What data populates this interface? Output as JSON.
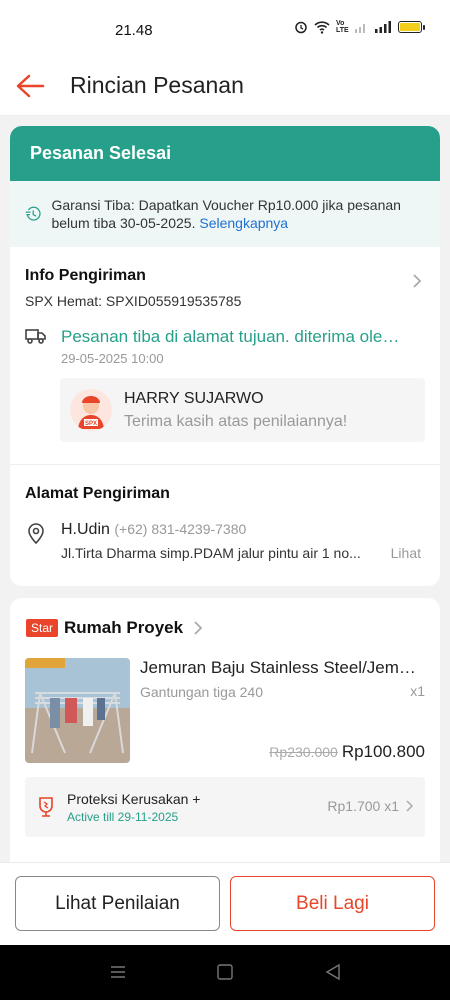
{
  "status_bar": {
    "time": "21.48",
    "signal_label": "Vo LTE"
  },
  "header": {
    "title": "Rincian Pesanan"
  },
  "order_status": {
    "label": "Pesanan Selesai"
  },
  "guarantee": {
    "text": "Garansi Tiba: Dapatkan Voucher Rp10.000 jika pesanan belum tiba 30-05-2025.",
    "link": "Selengkapnya"
  },
  "shipping": {
    "title": "Info Pengiriman",
    "service": "SPX Hemat: SPXID055919535785",
    "status": "Pesanan tiba di alamat tujuan. diterima oleh ...",
    "time": "29-05-2025 10:00",
    "courier_name": "HARRY SUJARWO",
    "courier_message": "Terima kasih atas penilaiannya!",
    "courier_logo": "SPX"
  },
  "address": {
    "title": "Alamat Pengiriman",
    "name": "H.Udin",
    "phone": "(+62) 831-4239-7380",
    "detail": "Jl.Tirta Dharma simp.PDAM jalur pintu air 1 no...",
    "more": "Lihat"
  },
  "shop": {
    "badge": "Star",
    "name": "Rumah Proyek"
  },
  "product": {
    "name": "Jemuran Baju Stainless Steel/Jemuran",
    "variant": "Gantungan tiga 240",
    "qty": "x1",
    "price_old": "Rp230.000",
    "price_new": "Rp100.800"
  },
  "protection": {
    "title": "Proteksi Kerusakan +",
    "active": "Active till 29-11-2025",
    "price": "Rp1.700 x1"
  },
  "actions": {
    "review": "Lihat Penilaian",
    "buy_again": "Beli Lagi"
  },
  "colors": {
    "primary": "#e8452a",
    "teal": "#26a08a",
    "link": "#1f6fd1"
  },
  "icons": [
    "back-arrow-icon",
    "voucher-clock-icon",
    "chevron-right-icon",
    "truck-icon",
    "location-pin-icon",
    "shield-icon",
    "menu-icon",
    "home-icon",
    "back-icon"
  ]
}
